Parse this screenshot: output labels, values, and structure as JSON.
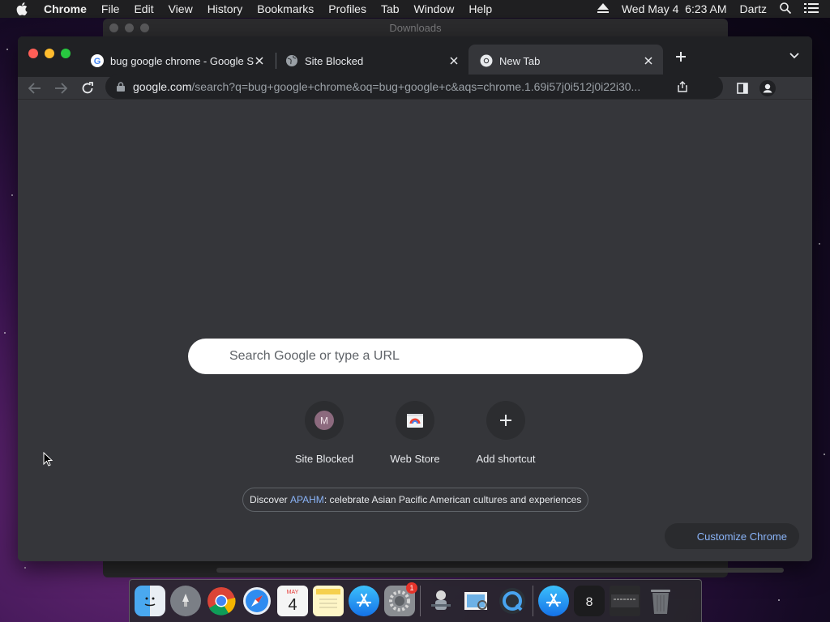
{
  "menubar": {
    "items": [
      "Chrome",
      "File",
      "Edit",
      "View",
      "History",
      "Bookmarks",
      "Profiles",
      "Tab",
      "Window",
      "Help"
    ],
    "datetime": "Wed May 4  6:23 AM",
    "user": "Dartz"
  },
  "background_window": {
    "title": "Downloads"
  },
  "tabs": [
    {
      "title": "bug google chrome - Google S",
      "icon": "google-g-icon"
    },
    {
      "title": "Site Blocked",
      "icon": "globe-icon"
    },
    {
      "title": "New Tab",
      "icon": "chrome-icon"
    }
  ],
  "omnibox": {
    "host": "google.com",
    "path": "/search?q=bug+google+chrome&oq=bug+google+c&aqs=chrome.1.69i57j0i512j0i22i30..."
  },
  "search": {
    "placeholder": "Search Google or type a URL"
  },
  "shortcuts": [
    {
      "label": "Site Blocked",
      "letter": "M"
    },
    {
      "label": "Web Store"
    },
    {
      "label": "Add shortcut"
    }
  ],
  "promo": {
    "prefix": "Discover ",
    "link": "APAHM",
    "suffix": ": celebrate Asian Pacific American cultures and experiences"
  },
  "customize_label": "Customize Chrome",
  "dock": {
    "calendar_day": "4",
    "calendar_month": "MAY",
    "settings_badge": "1"
  },
  "colors": {
    "accent_link": "#8ab4f8",
    "tab_strip": "#202124",
    "page_bg": "#35363a"
  }
}
